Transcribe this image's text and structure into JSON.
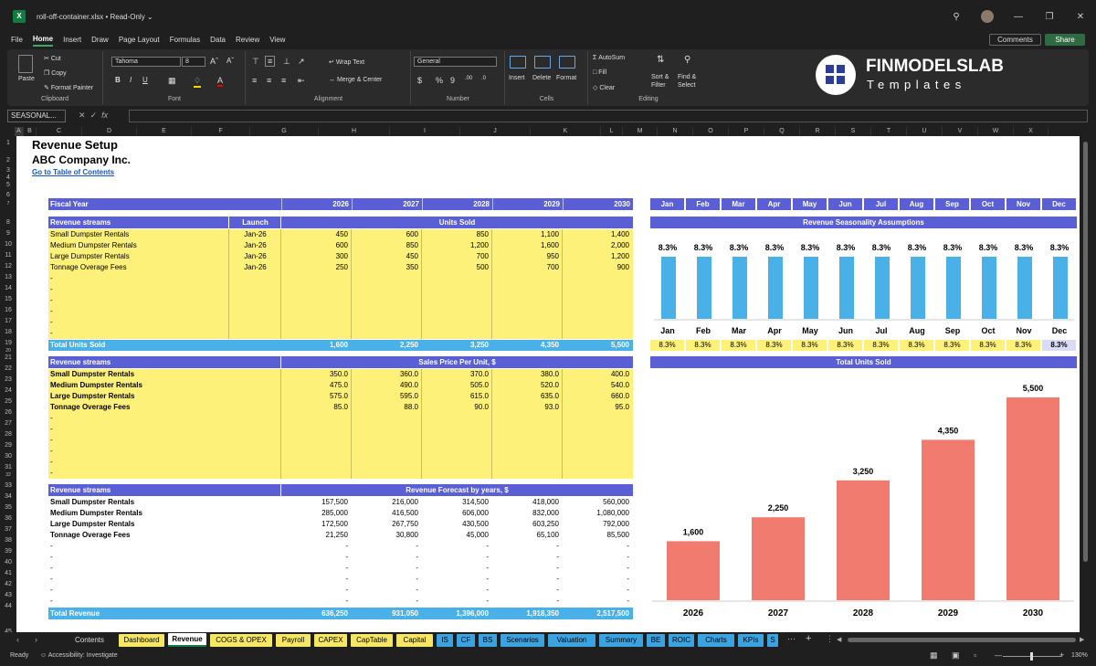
{
  "window": {
    "title": "roll-off-container.xlsx  •  Read-Only ⌄"
  },
  "menu": [
    "File",
    "Home",
    "Insert",
    "Draw",
    "Page Layout",
    "Formulas",
    "Data",
    "Review",
    "View"
  ],
  "menu_active": "Home",
  "buttons": {
    "comments": "Comments",
    "share": "Share"
  },
  "ribbon": {
    "paste": "Paste",
    "cut": "Cut",
    "copy": "Copy",
    "format_painter": "Format Painter",
    "clipboard": "Clipboard",
    "font_name": "Tahoma",
    "font_size": "8",
    "font": "Font",
    "wrap_text": "Wrap Text",
    "merge_center": "Merge & Center",
    "alignment": "Alignment",
    "number_format": "General",
    "number": "Number",
    "insert": "Insert",
    "delete": "Delete",
    "format": "Format",
    "cells": "Cells",
    "autosum": "AutoSum",
    "fill": "Fill",
    "clear": "Clear",
    "sort_filter": "Sort & Filter",
    "find_select": "Find & Select",
    "editing": "Editing"
  },
  "brand": {
    "line1": "FINMODELSLAB",
    "line2": "Templates"
  },
  "formula_bar": {
    "name_box": "SEASONAL...",
    "fx": "fx"
  },
  "columns": [
    "A",
    "B",
    "C",
    "D",
    "E",
    "F",
    "G",
    "H",
    "I",
    "J",
    "K",
    "L",
    "M",
    "N",
    "O",
    "P",
    "Q",
    "R",
    "S",
    "T",
    "U",
    "V",
    "W",
    "X"
  ],
  "rows": [
    "1",
    "2",
    "3",
    "4",
    "5",
    "6",
    "7",
    "8",
    "9",
    "10",
    "11",
    "12",
    "13",
    "14",
    "15",
    "16",
    "17",
    "18",
    "19",
    "20",
    "21",
    "22",
    "23",
    "24",
    "25",
    "26",
    "27",
    "28",
    "29",
    "30",
    "31",
    "32",
    "33",
    "34",
    "35",
    "36",
    "37",
    "38",
    "39",
    "40",
    "41",
    "42",
    "43",
    "44",
    "45"
  ],
  "sheet": {
    "title": "Revenue Setup",
    "company": "ABC Company Inc.",
    "toc_link": "Go to Table of Contents",
    "fiscal_year_label": "Fiscal Year",
    "years": [
      "2026",
      "2027",
      "2028",
      "2029",
      "2030"
    ],
    "months": [
      "Jan",
      "Feb",
      "Mar",
      "Apr",
      "May",
      "Jun",
      "Jul",
      "Aug",
      "Sep",
      "Oct",
      "Nov",
      "Dec"
    ],
    "units": {
      "header": "Revenue streams",
      "launch_header": "Launch",
      "section": "Units Sold",
      "rows": [
        {
          "name": "Small Dumpster Rentals",
          "launch": "Jan-26",
          "values": [
            "450",
            "600",
            "850",
            "1,100",
            "1,400"
          ]
        },
        {
          "name": "Medium Dumpster Rentals",
          "launch": "Jan-26",
          "values": [
            "600",
            "850",
            "1,200",
            "1,600",
            "2,000"
          ]
        },
        {
          "name": "Large Dumpster Rentals",
          "launch": "Jan-26",
          "values": [
            "300",
            "450",
            "700",
            "950",
            "1,200"
          ]
        },
        {
          "name": "Tonnage Overage Fees",
          "launch": "Jan-26",
          "values": [
            "250",
            "350",
            "500",
            "700",
            "900"
          ]
        }
      ],
      "blank": "-",
      "total_label": "Total Units Sold",
      "totals": [
        "1,600",
        "2,250",
        "3,250",
        "4,350",
        "5,500"
      ]
    },
    "price": {
      "header": "Revenue streams",
      "section": "Sales Price Per Unit, $",
      "rows": [
        {
          "name": "Small Dumpster Rentals",
          "values": [
            "350.0",
            "360.0",
            "370.0",
            "380.0",
            "400.0"
          ]
        },
        {
          "name": "Medium Dumpster Rentals",
          "values": [
            "475.0",
            "490.0",
            "505.0",
            "520.0",
            "540.0"
          ]
        },
        {
          "name": "Large Dumpster Rentals",
          "values": [
            "575.0",
            "595.0",
            "615.0",
            "635.0",
            "660.0"
          ]
        },
        {
          "name": "Tonnage Overage Fees",
          "values": [
            "85.0",
            "88.0",
            "90.0",
            "93.0",
            "95.0"
          ]
        }
      ]
    },
    "revenue": {
      "header": "Revenue streams",
      "section": "Revenue Forecast by years, $",
      "rows": [
        {
          "name": "Small Dumpster Rentals",
          "values": [
            "157,500",
            "216,000",
            "314,500",
            "418,000",
            "560,000"
          ]
        },
        {
          "name": "Medium Dumpster Rentals",
          "values": [
            "285,000",
            "416,500",
            "606,000",
            "832,000",
            "1,080,000"
          ]
        },
        {
          "name": "Large Dumpster Rentals",
          "values": [
            "172,500",
            "267,750",
            "430,500",
            "603,250",
            "792,000"
          ]
        },
        {
          "name": "Tonnage Overage Fees",
          "values": [
            "21,250",
            "30,800",
            "45,000",
            "65,100",
            "85,500"
          ]
        }
      ],
      "total_label": "Total Revenue",
      "totals": [
        "636,250",
        "931,050",
        "1,396,000",
        "1,918,350",
        "2,517,500"
      ]
    },
    "seasonality": {
      "title": "Revenue Seasonality Assumptions",
      "labels": [
        "8.3%",
        "8.3%",
        "8.3%",
        "8.3%",
        "8.3%",
        "8.3%",
        "8.3%",
        "8.3%",
        "8.3%",
        "8.3%",
        "8.3%",
        "8.3%"
      ]
    },
    "units_chart_title": "Total Units Sold"
  },
  "chart_data": [
    {
      "type": "bar",
      "title": "Revenue Seasonality Assumptions",
      "categories": [
        "Jan",
        "Feb",
        "Mar",
        "Apr",
        "May",
        "Jun",
        "Jul",
        "Aug",
        "Sep",
        "Oct",
        "Nov",
        "Dec"
      ],
      "values": [
        8.3,
        8.3,
        8.3,
        8.3,
        8.3,
        8.3,
        8.3,
        8.3,
        8.3,
        8.3,
        8.3,
        8.3
      ],
      "color": "#4ab0e8"
    },
    {
      "type": "bar",
      "title": "Total Units Sold",
      "categories": [
        "2026",
        "2027",
        "2028",
        "2029",
        "2030"
      ],
      "values": [
        1600,
        2250,
        3250,
        4350,
        5500
      ],
      "color": "#f07b6e"
    }
  ],
  "tabs": [
    {
      "label": "Contents",
      "color": "#1f1f1f",
      "text": "#ddd"
    },
    {
      "label": "Dashboard",
      "color": "#f5e663",
      "text": "#000"
    },
    {
      "label": "Revenue",
      "color": "#ffffff",
      "text": "#000"
    },
    {
      "label": "COGS & OPEX",
      "color": "#f5e663",
      "text": "#000"
    },
    {
      "label": "Payroll",
      "color": "#f5e663",
      "text": "#000"
    },
    {
      "label": "CAPEX",
      "color": "#f5e663",
      "text": "#000"
    },
    {
      "label": "CapTable",
      "color": "#f5e663",
      "text": "#000"
    },
    {
      "label": "Capital",
      "color": "#f5e663",
      "text": "#000"
    },
    {
      "label": "IS",
      "color": "#3aa3e0",
      "text": "#000"
    },
    {
      "label": "CF",
      "color": "#3aa3e0",
      "text": "#000"
    },
    {
      "label": "BS",
      "color": "#3aa3e0",
      "text": "#000"
    },
    {
      "label": "Scenarios",
      "color": "#3aa3e0",
      "text": "#000"
    },
    {
      "label": "Valuation",
      "color": "#3aa3e0",
      "text": "#000"
    },
    {
      "label": "Summary",
      "color": "#3aa3e0",
      "text": "#000"
    },
    {
      "label": "BE",
      "color": "#3aa3e0",
      "text": "#000"
    },
    {
      "label": "ROIC",
      "color": "#3aa3e0",
      "text": "#000"
    },
    {
      "label": "Charts",
      "color": "#3aa3e0",
      "text": "#000"
    },
    {
      "label": "KPIs",
      "color": "#3aa3e0",
      "text": "#000"
    },
    {
      "label": "S",
      "color": "#3aa3e0",
      "text": "#000"
    }
  ],
  "status": {
    "ready": "Ready",
    "accessibility": "Accessibility: Investigate",
    "zoom": "130%"
  },
  "colors": {
    "header_blue": "#5a5fd6",
    "input_yellow": "#fdf17a",
    "total_blue": "#4ab0e8",
    "bar_blue": "#4ab0e8",
    "bar_red": "#f07b6e",
    "cell_highlight": "#d9dcf4"
  }
}
